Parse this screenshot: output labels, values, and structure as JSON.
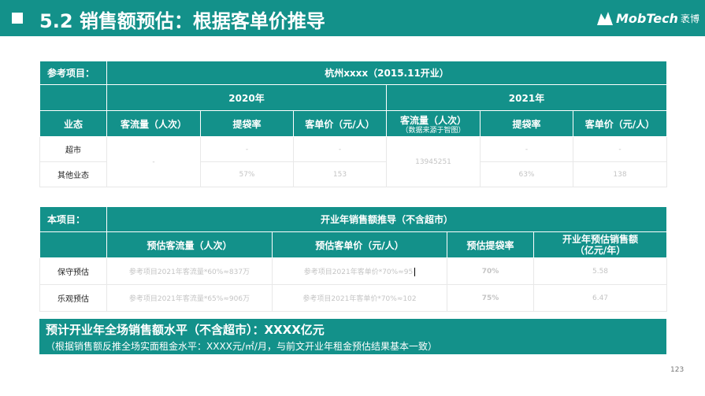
{
  "header": {
    "title": "5.2 销售额预估：根据客单价推导",
    "logo_text": "MobTech",
    "logo_cn": "袤博"
  },
  "ref_table": {
    "label": "参考项目：",
    "project": "杭州xxxx（2015.11开业）",
    "year1": "2020年",
    "year2": "2021年",
    "col_category": "业态",
    "col_traffic": "客流量（人次）",
    "col_bag_rate": "提袋率",
    "col_unit_price": "客单价（元/人）",
    "col_traffic2": "客流量（人次）",
    "col_traffic2_note": "（数据来源于智图）",
    "rows": [
      {
        "category": "超市",
        "bag_2020": "-",
        "price_2020": "-",
        "bag_2021": "-",
        "price_2021": "-"
      },
      {
        "category": "其他业态",
        "bag_2020": "57%",
        "price_2020": "153",
        "bag_2021": "63%",
        "price_2021": "138"
      }
    ],
    "traffic_2020": "-",
    "traffic_2021": "13945251"
  },
  "proj_table": {
    "label": "本项目：",
    "title": "开业年销售额推导（不含超市）",
    "col_traffic": "预估客流量（人次）",
    "col_price": "预估客单价（元/人）",
    "col_bag": "预估提袋率",
    "col_sales_l1": "开业年预估销售额",
    "col_sales_l2": "（亿元/年）",
    "rows": [
      {
        "name": "保守预估",
        "traffic": "参考项目2021年客流量*60%≈837万",
        "price": "参考项目2021年客单价*70%≈95",
        "bag": "70%",
        "sales": "5.58"
      },
      {
        "name": "乐观预估",
        "traffic": "参考项目2021年客流量*65%≈906万",
        "price": "参考项目2021年客单价*70%≈102",
        "bag": "75%",
        "sales": "6.47"
      }
    ]
  },
  "banner": {
    "line1": "预计开业年全场销售额水平（不含超市）：XXXX亿元",
    "line2": "（根据销售额反推全场实面租金水平：XXXX元/㎡/月，与前文开业年租金预估结果基本一致）"
  },
  "page_number": "123",
  "colors": {
    "accent": "#13918a"
  }
}
